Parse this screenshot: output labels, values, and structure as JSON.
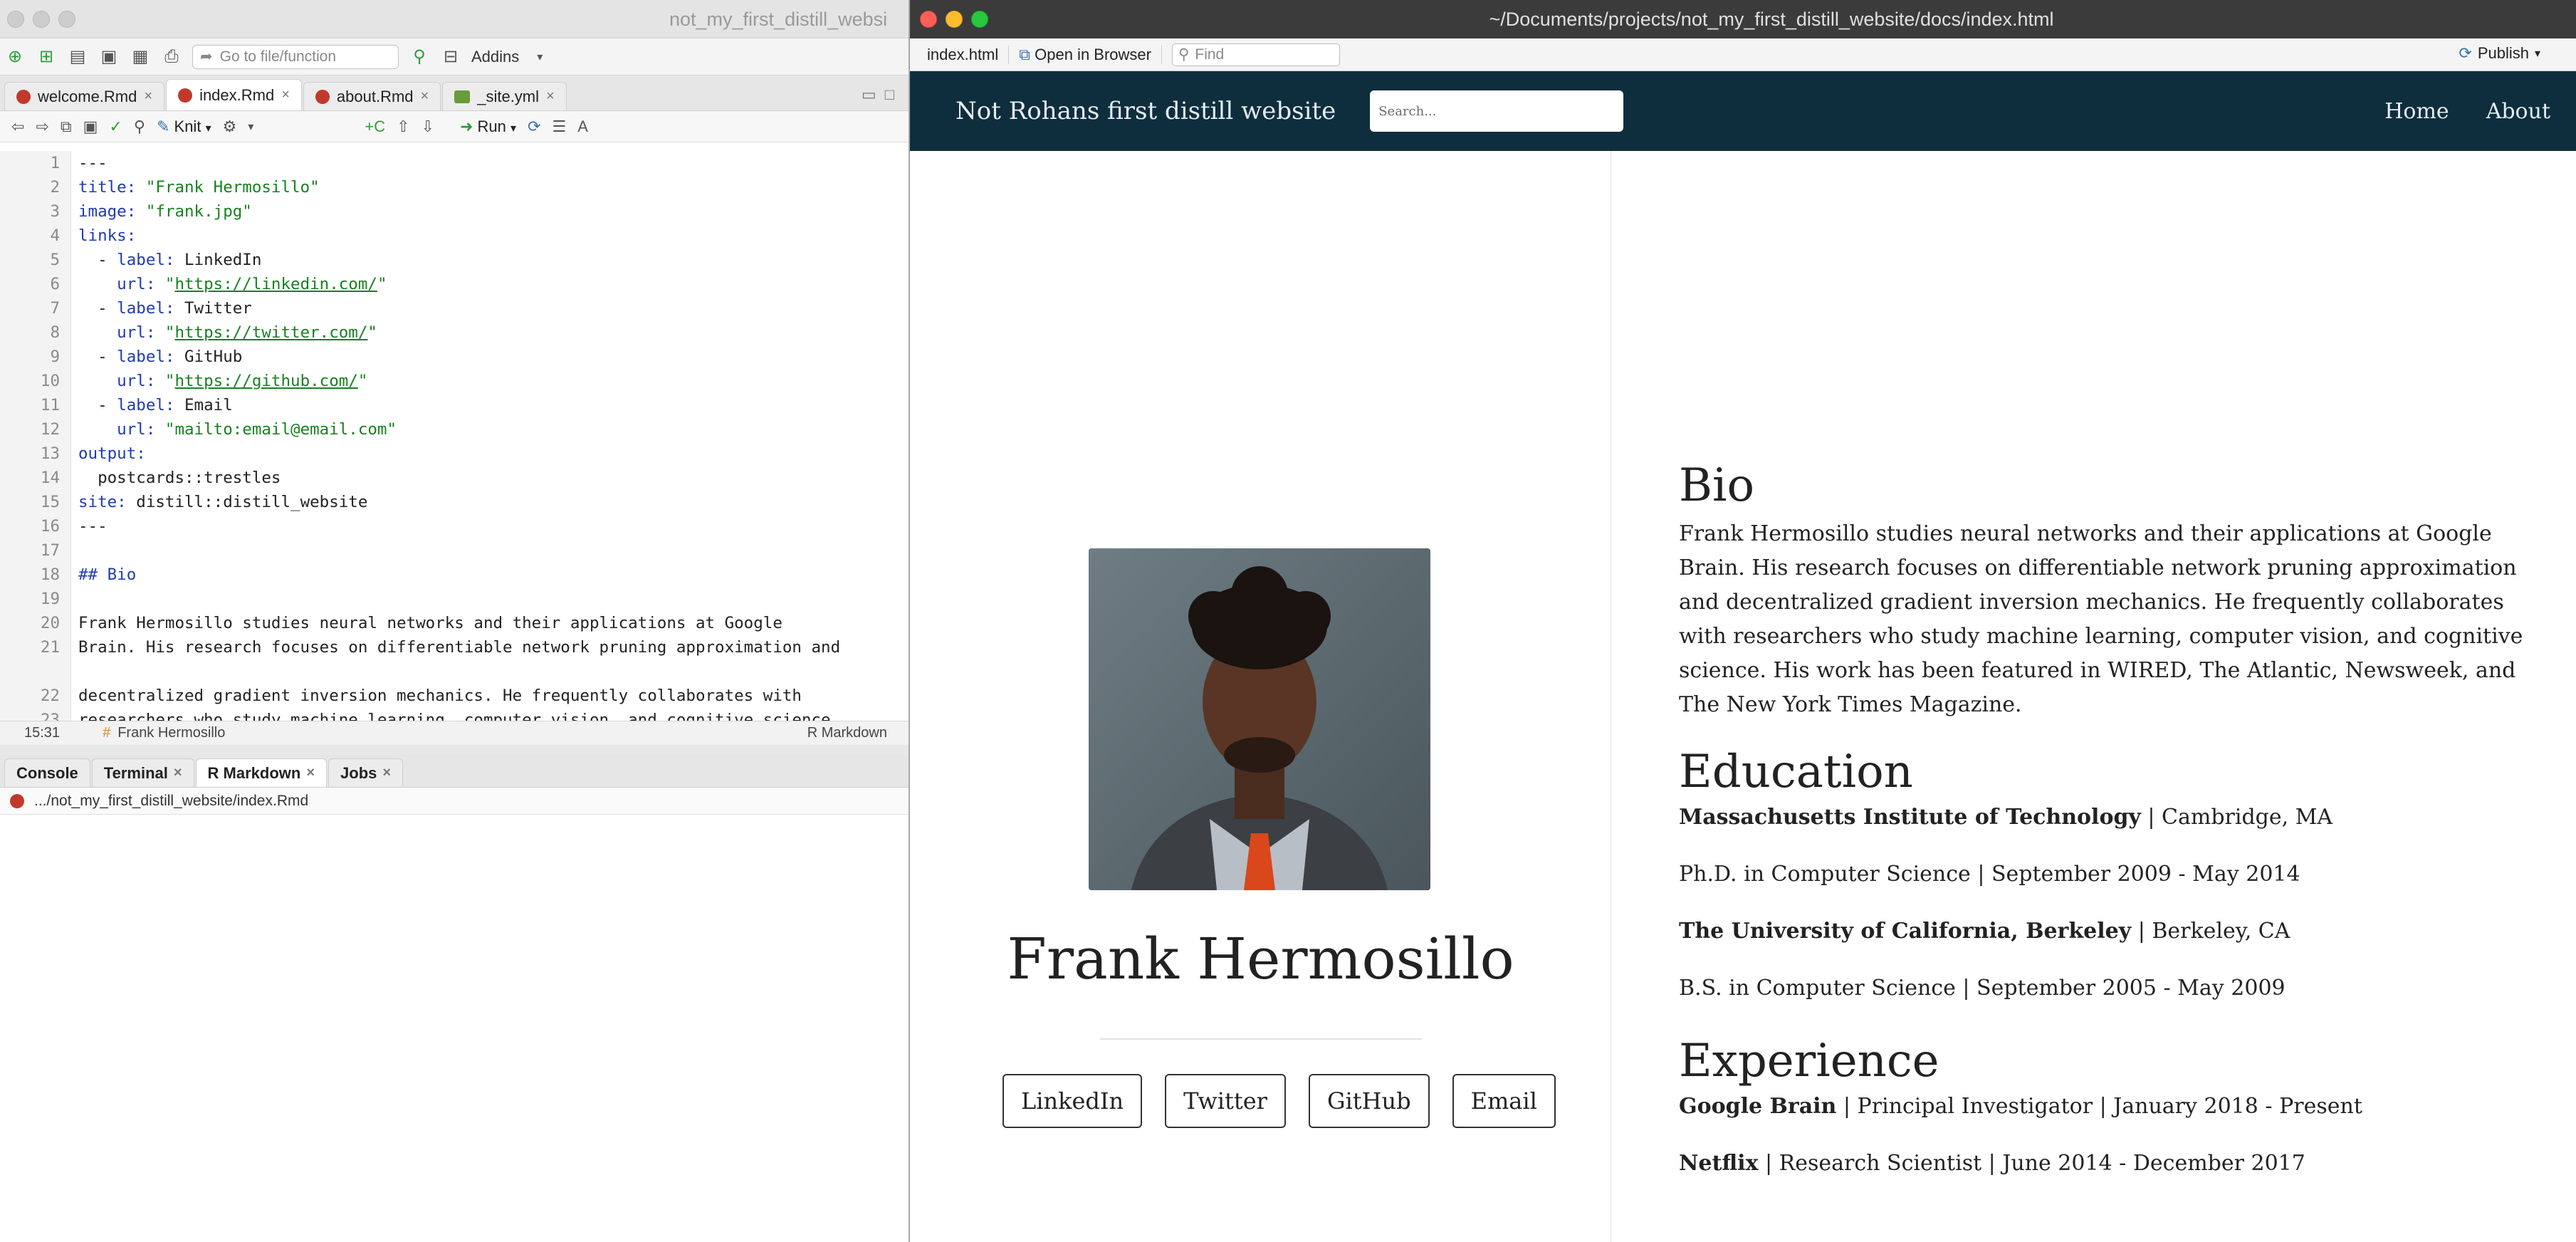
{
  "rstudio": {
    "window_title": "not_my_first_distill_websi",
    "goto_placeholder": "Go to file/function",
    "addins_label": "Addins",
    "tabs": [
      {
        "label": "welcome.Rmd",
        "kind": "rmd"
      },
      {
        "label": "index.Rmd",
        "kind": "rmd"
      },
      {
        "label": "about.Rmd",
        "kind": "rmd"
      },
      {
        "label": "_site.yml",
        "kind": "yml"
      }
    ],
    "knit_label": "Knit",
    "run_label": "Run",
    "code_lines": [
      {
        "n": "1",
        "segs": [
          {
            "t": "---",
            "c": "p"
          }
        ]
      },
      {
        "n": "2",
        "segs": [
          {
            "t": "title:",
            "c": "k"
          },
          {
            "t": " \"Frank Hermosillo\"",
            "c": "s"
          }
        ]
      },
      {
        "n": "3",
        "segs": [
          {
            "t": "image:",
            "c": "k"
          },
          {
            "t": " \"frank.jpg\"",
            "c": "s"
          }
        ]
      },
      {
        "n": "4",
        "segs": [
          {
            "t": "links:",
            "c": "k"
          }
        ]
      },
      {
        "n": "5",
        "segs": [
          {
            "t": "  - ",
            "c": "p"
          },
          {
            "t": "label:",
            "c": "k"
          },
          {
            "t": " LinkedIn",
            "c": "p"
          }
        ]
      },
      {
        "n": "6",
        "segs": [
          {
            "t": "    url:",
            "c": "k"
          },
          {
            "t": " \"",
            "c": "s"
          },
          {
            "t": "https://linkedin.com/",
            "c": "u"
          },
          {
            "t": "\"",
            "c": "s"
          }
        ]
      },
      {
        "n": "7",
        "segs": [
          {
            "t": "  - ",
            "c": "p"
          },
          {
            "t": "label:",
            "c": "k"
          },
          {
            "t": " Twitter",
            "c": "p"
          }
        ]
      },
      {
        "n": "8",
        "segs": [
          {
            "t": "    url:",
            "c": "k"
          },
          {
            "t": " \"",
            "c": "s"
          },
          {
            "t": "https://twitter.com/",
            "c": "u"
          },
          {
            "t": "\"",
            "c": "s"
          }
        ]
      },
      {
        "n": "9",
        "segs": [
          {
            "t": "  - ",
            "c": "p"
          },
          {
            "t": "label:",
            "c": "k"
          },
          {
            "t": " GitHub",
            "c": "p"
          }
        ]
      },
      {
        "n": "10",
        "segs": [
          {
            "t": "    url:",
            "c": "k"
          },
          {
            "t": " \"",
            "c": "s"
          },
          {
            "t": "https://github.com/",
            "c": "u"
          },
          {
            "t": "\"",
            "c": "s"
          }
        ]
      },
      {
        "n": "11",
        "segs": [
          {
            "t": "  - ",
            "c": "p"
          },
          {
            "t": "label:",
            "c": "k"
          },
          {
            "t": " Email",
            "c": "p"
          }
        ]
      },
      {
        "n": "12",
        "segs": [
          {
            "t": "    url:",
            "c": "k"
          },
          {
            "t": " \"mailto:email@email.com\"",
            "c": "s"
          }
        ]
      },
      {
        "n": "13",
        "segs": [
          {
            "t": "output:",
            "c": "k"
          }
        ]
      },
      {
        "n": "14",
        "segs": [
          {
            "t": "  postcards::trestles",
            "c": "p"
          }
        ]
      },
      {
        "n": "15",
        "segs": [
          {
            "t": "site:",
            "c": "k"
          },
          {
            "t": " distill::distill_website",
            "c": "p"
          }
        ]
      },
      {
        "n": "16",
        "segs": [
          {
            "t": "---",
            "c": "p"
          }
        ]
      },
      {
        "n": "17",
        "segs": []
      },
      {
        "n": "18",
        "segs": [
          {
            "t": "## Bio",
            "c": "h"
          }
        ]
      },
      {
        "n": "19",
        "segs": []
      },
      {
        "n": "20",
        "segs": [
          {
            "t": "Frank Hermosillo studies neural networks and their applications at Google",
            "c": "p"
          }
        ]
      },
      {
        "n": "21",
        "segs": [
          {
            "t": "Brain. His research focuses on differentiable network pruning approximation and",
            "c": "p"
          }
        ]
      },
      {
        "n": "",
        "segs": []
      },
      {
        "n": "22",
        "segs": [
          {
            "t": "decentralized gradient inversion mechanics. He frequently collaborates with",
            "c": "p"
          }
        ]
      },
      {
        "n": "23",
        "segs": [
          {
            "t": "researchers who study machine learning, computer vision, and cognitive science.",
            "c": "p"
          }
        ]
      }
    ],
    "status": {
      "position": "15:31",
      "section": "Frank Hermosillo",
      "mode": "R Markdown"
    },
    "lower_tabs": [
      "Console",
      "Terminal",
      "R Markdown",
      "Jobs"
    ],
    "lower_path": ".../not_my_first_distill_website/index.Rmd"
  },
  "viewer": {
    "window_title": "~/Documents/projects/not_my_first_distill_website/docs/index.html",
    "file_label": "index.html",
    "open_browser_label": "Open in Browser",
    "find_placeholder": "Find",
    "publish_label": "Publish"
  },
  "site": {
    "nav_title": "Not Rohans first distill website",
    "search_placeholder": "Search...",
    "nav_links": [
      "Home",
      "About"
    ],
    "name": "Frank Hermosillo",
    "links": [
      "LinkedIn",
      "Twitter",
      "GitHub",
      "Email"
    ],
    "bio_heading": "Bio",
    "bio_text": "Frank Hermosillo studies neural networks and their applications at Google Brain. His research focuses on differentiable network pruning approximation and decentralized gradient inversion mechanics. He frequently collaborates with researchers who study machine learning, computer vision, and cognitive science. His work has been featured in WIRED, The Atlantic, Newsweek, and The New York Times Magazine.",
    "education_heading": "Education",
    "education": [
      {
        "bold": "Massachusetts Institute of Technology",
        "rest": " | Cambridge, MA"
      },
      {
        "bold": "",
        "rest": "Ph.D. in Computer Science | September 2009 - May 2014"
      },
      {
        "bold": "The University of California, Berkeley",
        "rest": " | Berkeley, CA"
      },
      {
        "bold": "",
        "rest": "B.S. in Computer Science | September 2005 - May 2009"
      }
    ],
    "experience_heading": "Experience",
    "experience": [
      {
        "bold": "Google Brain",
        "rest": " | Principal Investigator | January 2018 - Present"
      },
      {
        "bold": "Netflix",
        "rest": " | Research Scientist | June 2014 - December 2017"
      }
    ]
  }
}
